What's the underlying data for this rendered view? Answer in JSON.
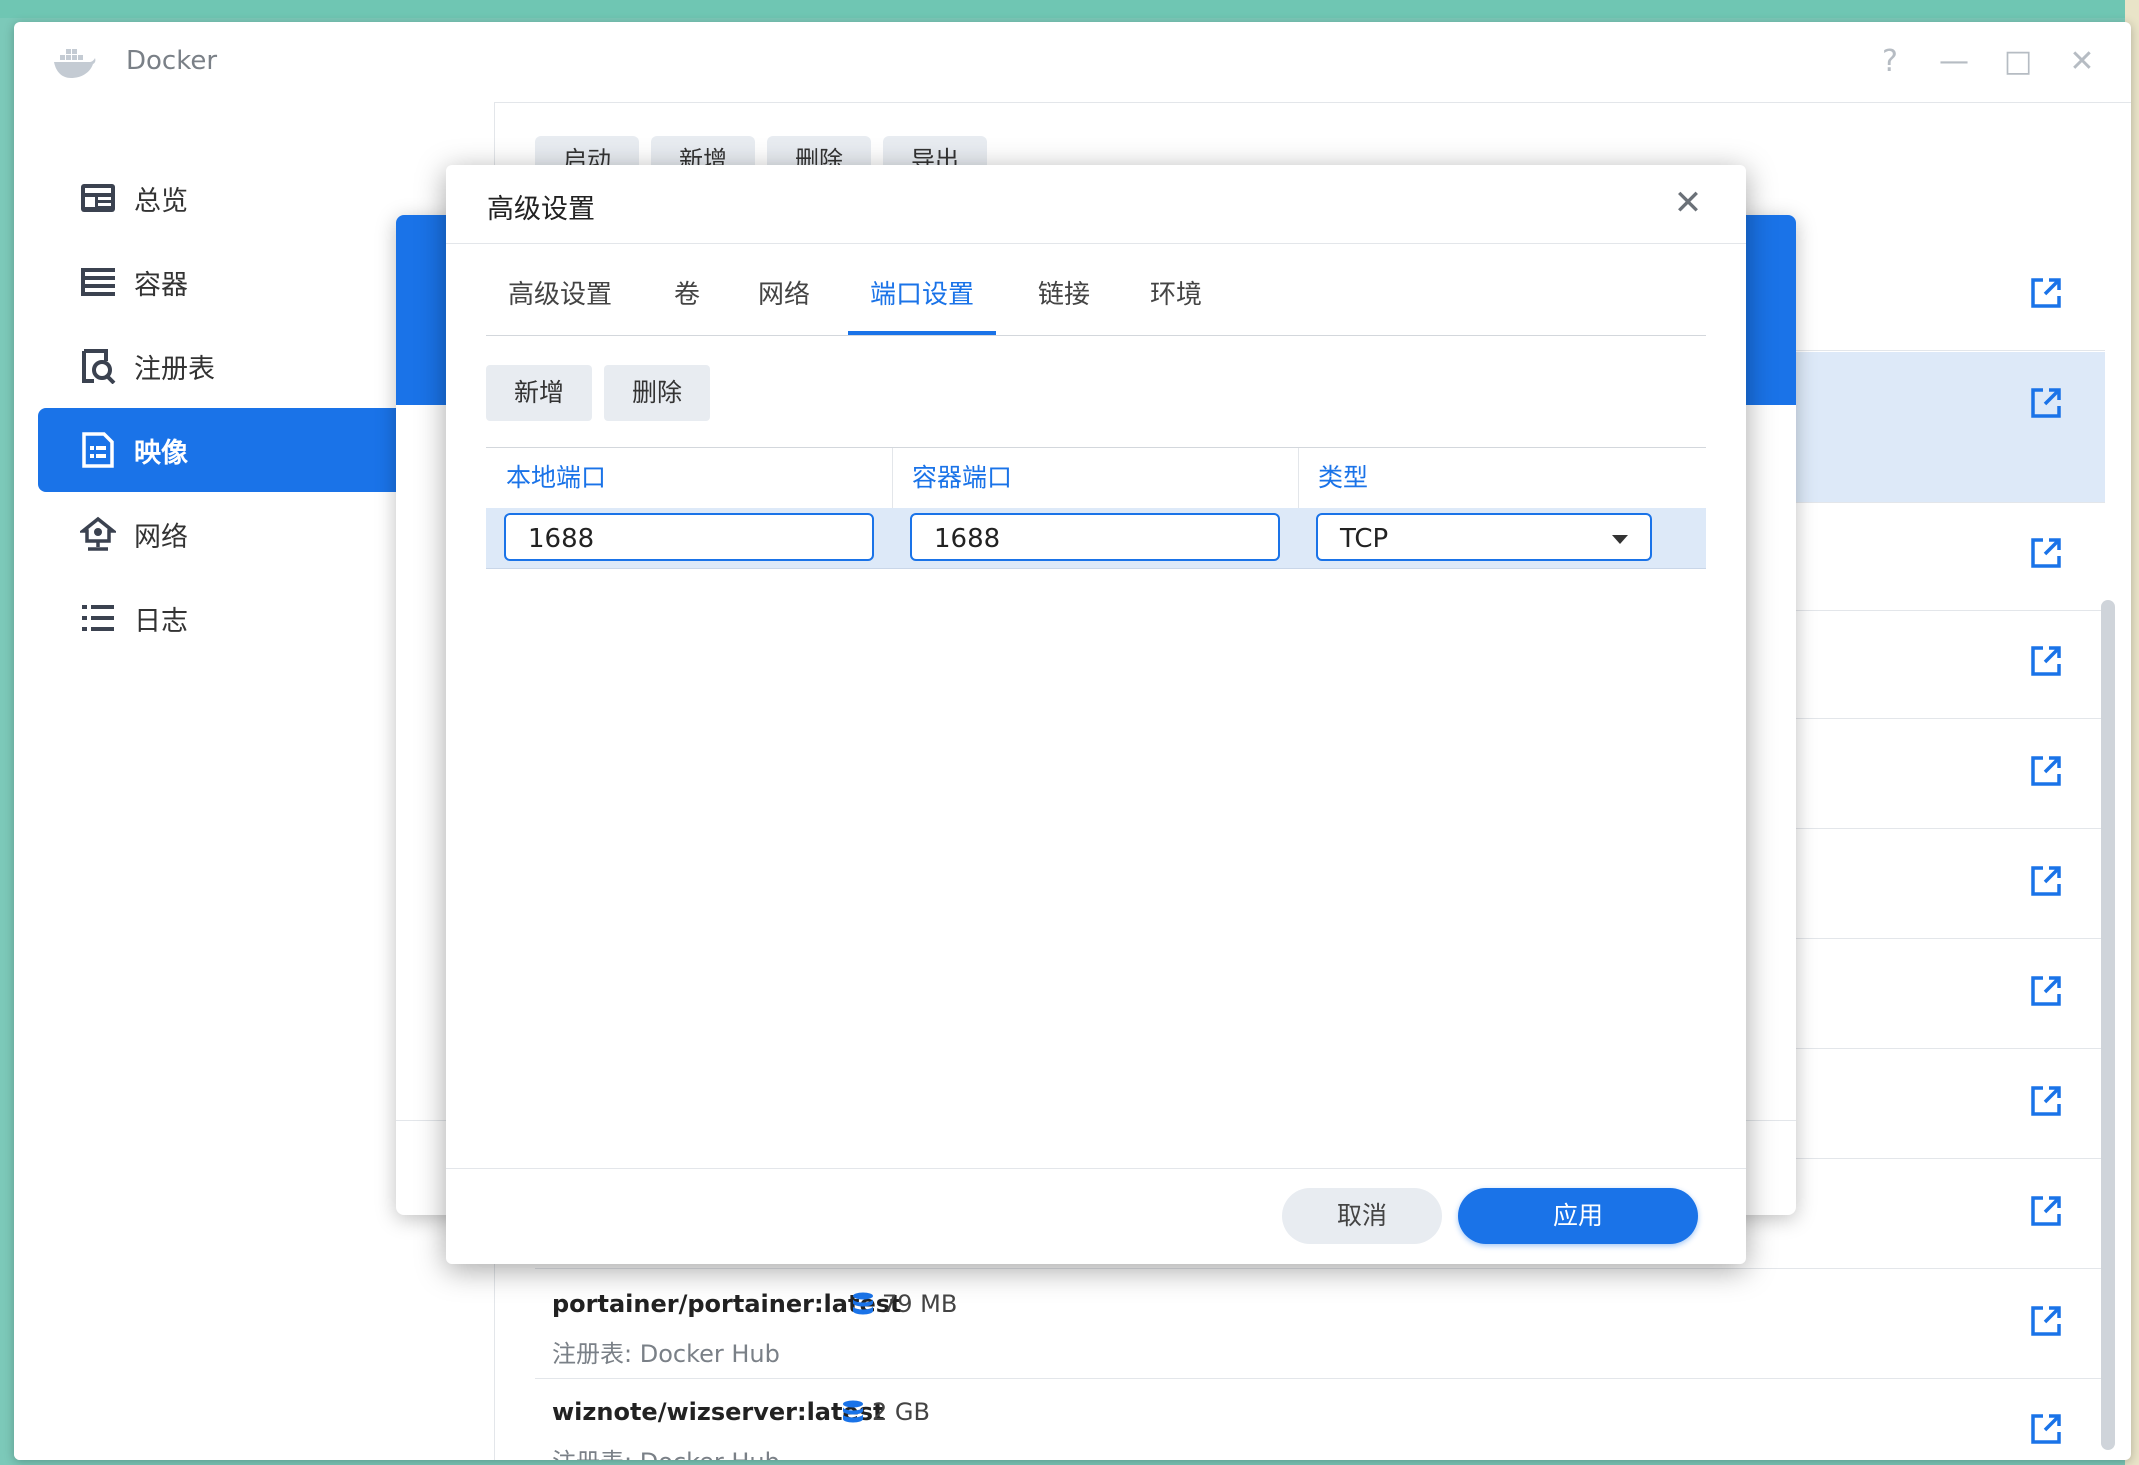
{
  "window": {
    "title": "Docker",
    "controls": [
      "?",
      "—",
      "□",
      "✕"
    ]
  },
  "sidebar": {
    "items": [
      {
        "label": "总览",
        "icon": "overview-icon",
        "active": false
      },
      {
        "label": "容器",
        "icon": "container-icon",
        "active": false
      },
      {
        "label": "注册表",
        "icon": "registry-icon",
        "active": false
      },
      {
        "label": "映像",
        "icon": "image-icon",
        "active": true
      },
      {
        "label": "网络",
        "icon": "network-icon",
        "active": false
      },
      {
        "label": "日志",
        "icon": "log-icon",
        "active": false
      }
    ]
  },
  "toolbar": {
    "buttons": [
      "启动",
      "新增",
      "删除",
      "导出"
    ]
  },
  "image_list": [
    {
      "name": "portainer/portainer:latest",
      "size": "79 MB",
      "registry": "注册表: Docker Hub"
    },
    {
      "name": "wiznote/wizserver:latest",
      "size": "2 GB",
      "registry": "注册表: Docker Hub"
    }
  ],
  "modal": {
    "title": "高级设置",
    "tabs": [
      "高级设置",
      "卷",
      "网络",
      "端口设置",
      "链接",
      "环境"
    ],
    "active_tab": "端口设置",
    "actions": {
      "add": "新增",
      "delete": "删除"
    },
    "table": {
      "headers": [
        "本地端口",
        "容器端口",
        "类型"
      ],
      "rows": [
        {
          "local_port": "1688",
          "container_port": "1688",
          "type": "TCP"
        }
      ]
    },
    "cancel": "取消",
    "apply": "应用"
  },
  "colors": {
    "accent": "#1a73e8",
    "selected_row": "#dde9f8",
    "desktop": "#7cc9b9"
  }
}
